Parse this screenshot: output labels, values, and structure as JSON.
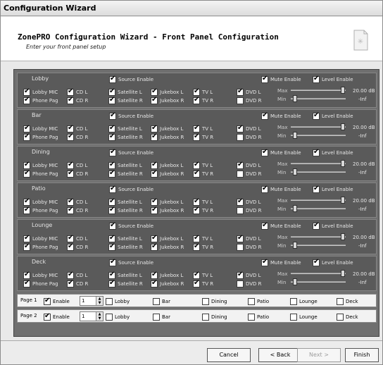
{
  "window": {
    "title": "Configuration Wizard"
  },
  "header": {
    "title": "ZonePRO Configuration Wizard - Front Panel Configuration",
    "subtitle": "Enter your front panel setup"
  },
  "labels": {
    "source_enable": "Source Enable",
    "mute_enable": "Mute Enable",
    "level_enable": "Level Enable",
    "max": "Max",
    "min": "Min",
    "max_value": "20.00 dB",
    "min_value": "-Inf",
    "sources": [
      "Lobby MIC",
      "CD L",
      "Satellite L",
      "Jukebox L",
      "TV L",
      "DVD L",
      "Phone Pag",
      "CD R",
      "Satellite R",
      "Jukebox R",
      "TV R",
      "DVD R"
    ]
  },
  "zones": [
    {
      "name": "Lobby",
      "source_enable": true,
      "mute_enable": true,
      "level_enable": true,
      "checks": [
        true,
        true,
        true,
        true,
        true,
        true,
        true,
        true,
        true,
        true,
        true,
        false
      ]
    },
    {
      "name": "Bar",
      "source_enable": true,
      "mute_enable": true,
      "level_enable": true,
      "checks": [
        true,
        true,
        true,
        true,
        true,
        true,
        true,
        true,
        true,
        true,
        true,
        false
      ]
    },
    {
      "name": "Dining",
      "source_enable": true,
      "mute_enable": true,
      "level_enable": true,
      "checks": [
        true,
        true,
        true,
        true,
        true,
        true,
        true,
        true,
        true,
        true,
        true,
        false
      ]
    },
    {
      "name": "Patio",
      "source_enable": true,
      "mute_enable": true,
      "level_enable": true,
      "checks": [
        true,
        true,
        true,
        true,
        true,
        true,
        true,
        true,
        true,
        true,
        true,
        false
      ]
    },
    {
      "name": "Lounge",
      "source_enable": true,
      "mute_enable": true,
      "level_enable": true,
      "checks": [
        true,
        true,
        true,
        true,
        true,
        true,
        true,
        true,
        true,
        true,
        true,
        false
      ]
    },
    {
      "name": "Deck",
      "source_enable": true,
      "mute_enable": true,
      "level_enable": true,
      "checks": [
        true,
        true,
        true,
        true,
        true,
        true,
        true,
        true,
        true,
        true,
        true,
        false
      ]
    }
  ],
  "pages": [
    {
      "name": "Page 1",
      "enable_label": "Enable",
      "enabled": true,
      "value": "1",
      "zone_labels": [
        "Lobby",
        "Bar",
        "Dining",
        "Patio",
        "Lounge",
        "Deck"
      ],
      "zone_checks": [
        false,
        false,
        false,
        false,
        false,
        false
      ]
    },
    {
      "name": "Page 2",
      "enable_label": "Enable",
      "enabled": true,
      "value": "1",
      "zone_labels": [
        "Lobby",
        "Bar",
        "Dining",
        "Patio",
        "Lounge",
        "Deck"
      ],
      "zone_checks": [
        false,
        false,
        false,
        false,
        false,
        false
      ]
    }
  ],
  "footer": {
    "cancel": "Cancel",
    "back": "< Back",
    "next": "Next >",
    "finish": "Finish"
  }
}
